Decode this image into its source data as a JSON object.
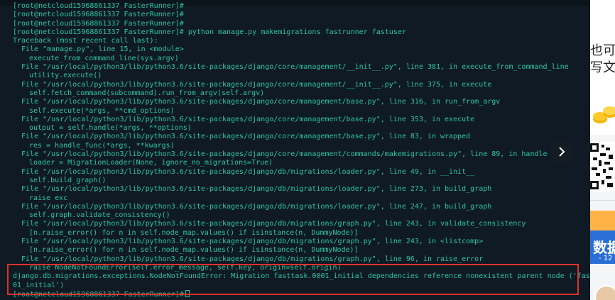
{
  "terminal": {
    "lines": [
      {
        "text": "[root@netcloud15968861337 FasterRunner]#",
        "indent": 0
      },
      {
        "text": "[root@netcloud15968861337 FasterRunner]#",
        "indent": 0
      },
      {
        "text": "[root@netcloud15968861337 FasterRunner]#",
        "indent": 0
      },
      {
        "text": "[root@netcloud15968861337 FasterRunner]# python manage.py makemigrations fastrunner fastuser",
        "indent": 0
      },
      {
        "text": "Traceback (most recent call last):",
        "indent": 0
      },
      {
        "text": "File \"manage.py\", line 15, in <module>",
        "indent": 1
      },
      {
        "text": "execute_from_command_line(sys.argv)",
        "indent": 2
      },
      {
        "text": "File \"/usr/local/python3/lib/python3.6/site-packages/django/core/management/__init__.py\", line 381, in execute_from_command_line",
        "indent": 1
      },
      {
        "text": "utility.execute()",
        "indent": 2
      },
      {
        "text": "File \"/usr/local/python3/lib/python3.6/site-packages/django/core/management/__init__.py\", line 375, in execute",
        "indent": 1
      },
      {
        "text": "self.fetch_command(subcommand).run_from_argv(self.argv)",
        "indent": 2
      },
      {
        "text": "File \"/usr/local/python3/lib/python3.6/site-packages/django/core/management/base.py\", line 316, in run_from_argv",
        "indent": 1
      },
      {
        "text": "self.execute(*args, **cmd_options)",
        "indent": 2
      },
      {
        "text": "File \"/usr/local/python3/lib/python3.6/site-packages/django/core/management/base.py\", line 353, in execute",
        "indent": 1
      },
      {
        "text": "output = self.handle(*args, **options)",
        "indent": 2
      },
      {
        "text": "File \"/usr/local/python3/lib/python3.6/site-packages/django/core/management/base.py\", line 83, in wrapped",
        "indent": 1
      },
      {
        "text": "res = handle_func(*args, **kwargs)",
        "indent": 2
      },
      {
        "text": "File \"/usr/local/python3/lib/python3.6/site-packages/django/core/management/commands/makemigrations.py\", line 89, in handle",
        "indent": 1
      },
      {
        "text": "loader = MigrationLoader(None, ignore_no_migrations=True)",
        "indent": 2
      },
      {
        "text": "File \"/usr/local/python3/lib/python3.6/site-packages/django/db/migrations/loader.py\", line 49, in __init__",
        "indent": 1
      },
      {
        "text": "self.build_graph()",
        "indent": 2
      },
      {
        "text": "File \"/usr/local/python3/lib/python3.6/site-packages/django/db/migrations/loader.py\", line 273, in build_graph",
        "indent": 1
      },
      {
        "text": "raise exc",
        "indent": 2
      },
      {
        "text": "File \"/usr/local/python3/lib/python3.6/site-packages/django/db/migrations/loader.py\", line 247, in build_graph",
        "indent": 1
      },
      {
        "text": "self.graph.validate_consistency()",
        "indent": 2
      },
      {
        "text": "File \"/usr/local/python3/lib/python3.6/site-packages/django/db/migrations/graph.py\", line 243, in validate_consistency",
        "indent": 1
      },
      {
        "text": "[n.raise_error() for n in self.node_map.values() if isinstance(n, DummyNode)]",
        "indent": 2
      },
      {
        "text": "File \"/usr/local/python3/lib/python3.6/site-packages/django/db/migrations/graph.py\", line 243, in <listcomp>",
        "indent": 1
      },
      {
        "text": "[n.raise_error() for n in self.node_map.values() if isinstance(n, DummyNode)]",
        "indent": 2
      },
      {
        "text": "File \"/usr/local/python3/lib/python3.6/site-packages/django/db/migrations/graph.py\", line 96, in raise_error",
        "indent": 1
      },
      {
        "text": "raise NodeNotFoundError(self.error_message, self.key, origin=self.origin)",
        "indent": 2
      },
      {
        "text": "django.db.migrations.exceptions.NodeNotFoundError: Migration fasttask.0001_initial dependencies reference nonexistent parent node ('fastru",
        "indent": 0
      },
      {
        "text": "01_initial')",
        "indent": 0
      },
      {
        "text": "[root@netcloud15968861337 FasterRunner]#",
        "indent": 0
      }
    ],
    "colors": {
      "background": "#0f1a24",
      "text": "#2cc6a0",
      "highlight_border": "#e0302a"
    }
  },
  "nav": {
    "next_icon": "chevron-right-icon"
  },
  "sidebar": {
    "ad_line1": "也可",
    "ad_line2": "写文",
    "card_title": "数据",
    "card_sub": "- 12"
  }
}
